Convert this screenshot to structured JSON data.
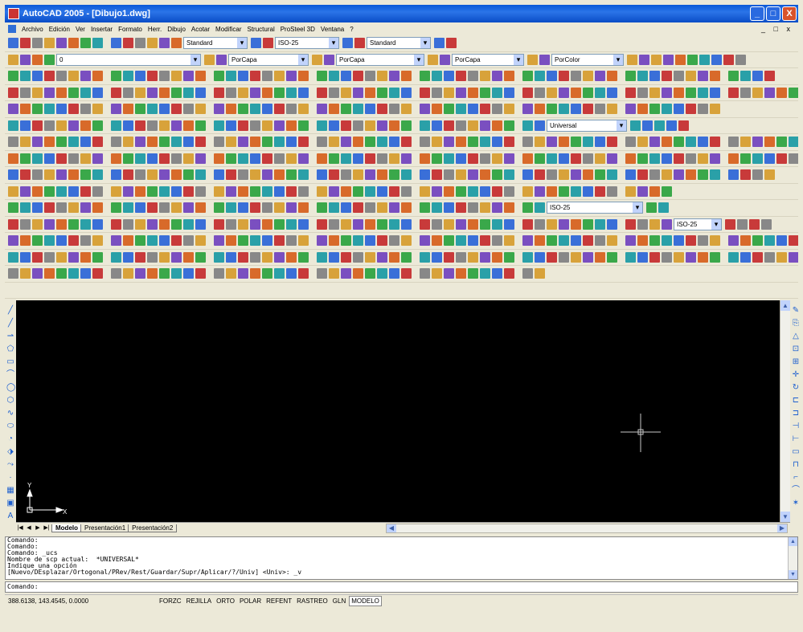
{
  "window": {
    "title": "AutoCAD 2005 - [Dibujo1.dwg]",
    "min": "_",
    "max": "□",
    "close": "X"
  },
  "menu": [
    "Archivo",
    "Edición",
    "Ver",
    "Insertar",
    "Formato",
    "Herr.",
    "Dibujo",
    "Acotar",
    "Modificar",
    "Structural",
    "ProSteel 3D",
    "Ventana",
    "?"
  ],
  "mdi_controls": "_ □ x",
  "combos": {
    "text_style": "Standard",
    "dim_style": "ISO-25",
    "table_style": "Standard",
    "layer": "0",
    "color": "PorCapa",
    "linetype": "PorCapa",
    "lineweight": "PorCapa",
    "plotstyle": "PorColor",
    "ucs": "Universal",
    "dim_style_2": "ISO-25"
  },
  "canvas": {
    "bg": "#000000",
    "ucs_x": "X",
    "ucs_y": "Y"
  },
  "tabs": [
    "Modelo",
    "Presentación1",
    "Presentación2"
  ],
  "command_history": [
    "Comando:",
    "Comando:",
    "Comando: _ucs",
    "Nombre de scp actual:  *UNIVERSAL*",
    "Indique una opción",
    "[Nuevo/DEsplazar/Ortogonal/PRev/Rest/Guardar/Supr/Aplicar/?/Univ] <Univ>: _v"
  ],
  "command_prompt": "Comando:",
  "status": {
    "coords": "388.6138, 143.4545, 0.0000",
    "toggles": [
      "FORZC",
      "REJILLA",
      "ORTO",
      "POLAR",
      "REFENT",
      "RASTREO",
      "GLN",
      "MODELO"
    ]
  },
  "colors": {
    "titlebar": "#0a5ad7",
    "accent": "#c1d3fb"
  }
}
